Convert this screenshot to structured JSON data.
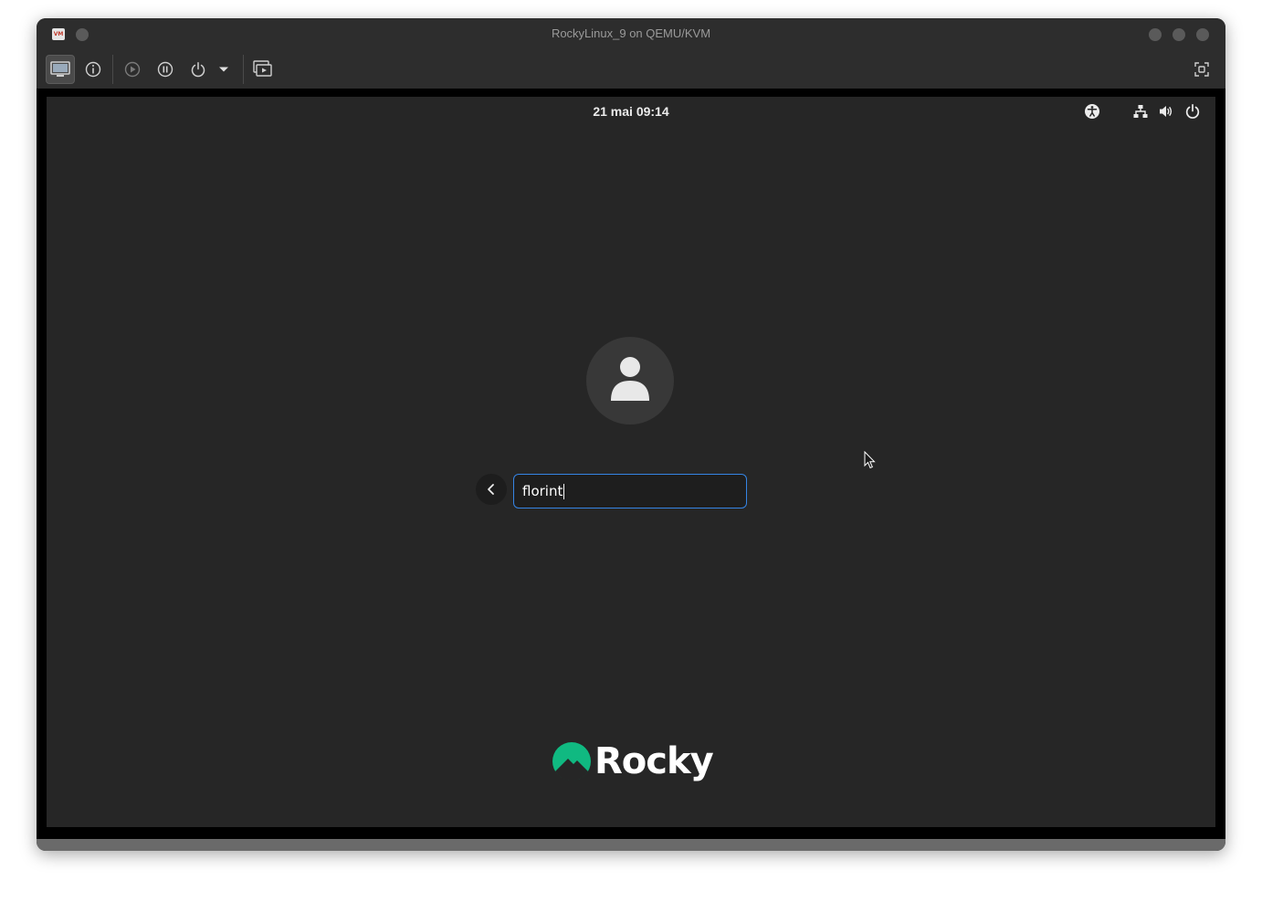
{
  "window": {
    "title": "RockyLinux_9 on QEMU/KVM",
    "app_icon": "virt-manager-icon"
  },
  "toolbar": {
    "buttons": [
      {
        "name": "console-view-button",
        "icon": "monitor-icon"
      },
      {
        "name": "details-view-button",
        "icon": "info-icon"
      },
      {
        "name": "run-button",
        "icon": "play-icon"
      },
      {
        "name": "pause-button",
        "icon": "pause-icon"
      },
      {
        "name": "shutdown-button",
        "icon": "power-icon"
      },
      {
        "name": "shutdown-menu-button",
        "icon": "dropdown-arrow-icon"
      },
      {
        "name": "snapshots-button",
        "icon": "snapshot-icon"
      },
      {
        "name": "fullscreen-button",
        "icon": "fullscreen-icon"
      }
    ]
  },
  "guest": {
    "clock": "21 mai  09:14",
    "status_icons": [
      "accessibility-icon",
      "network-icon",
      "volume-icon",
      "power-icon"
    ],
    "login": {
      "username_value": "florint"
    },
    "logo_text": "Rocky",
    "colors": {
      "background": "#262626",
      "focus_border": "#3584e4",
      "logo_green": "#10b981"
    }
  }
}
